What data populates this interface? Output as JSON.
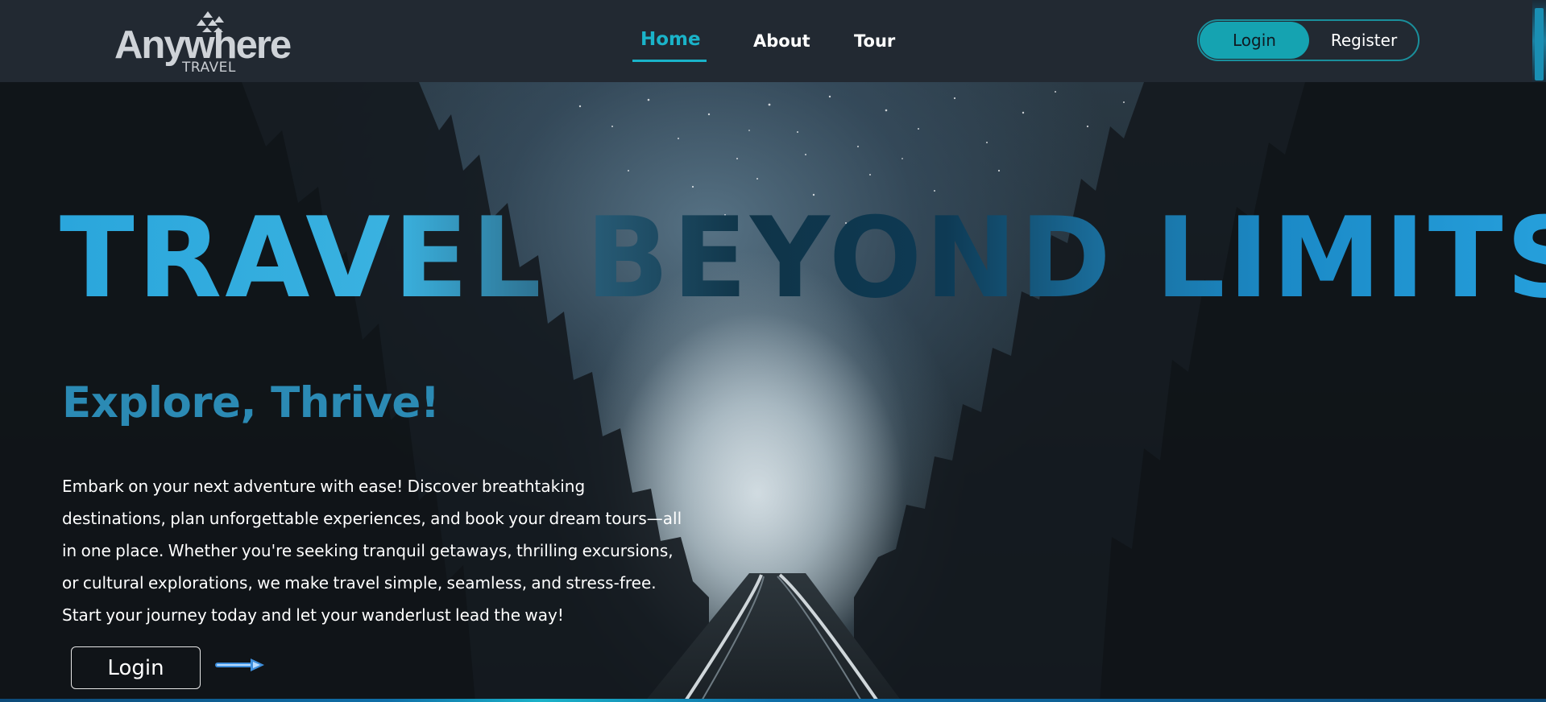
{
  "brand": {
    "name": "Anywhere",
    "sub": "TRAVEL"
  },
  "nav": {
    "home": "Home",
    "about": "About",
    "tour": "Tour"
  },
  "auth": {
    "login": "Login",
    "register": "Register"
  },
  "hero": {
    "title": "TRAVEL BEYOND LIMITS",
    "subtitle": "Explore, Thrive!",
    "body_lines": [
      "Embark on your next adventure with ease! Discover breathtaking",
      "destinations, plan unforgettable experiences, and book your dream tours—all",
      "in one place. Whether you're seeking tranquil getaways, thrilling excursions,",
      "or cultural explorations, we make travel simple, seamless, and stress-free.",
      "Start your journey today and let your wanderlust lead the way!"
    ],
    "cta_login": "Login"
  },
  "colors": {
    "accent": "#1ab3c9",
    "header_bg": "#222932",
    "title_blue": "#2aa6dc",
    "subtitle_blue": "#2b8ab4"
  }
}
